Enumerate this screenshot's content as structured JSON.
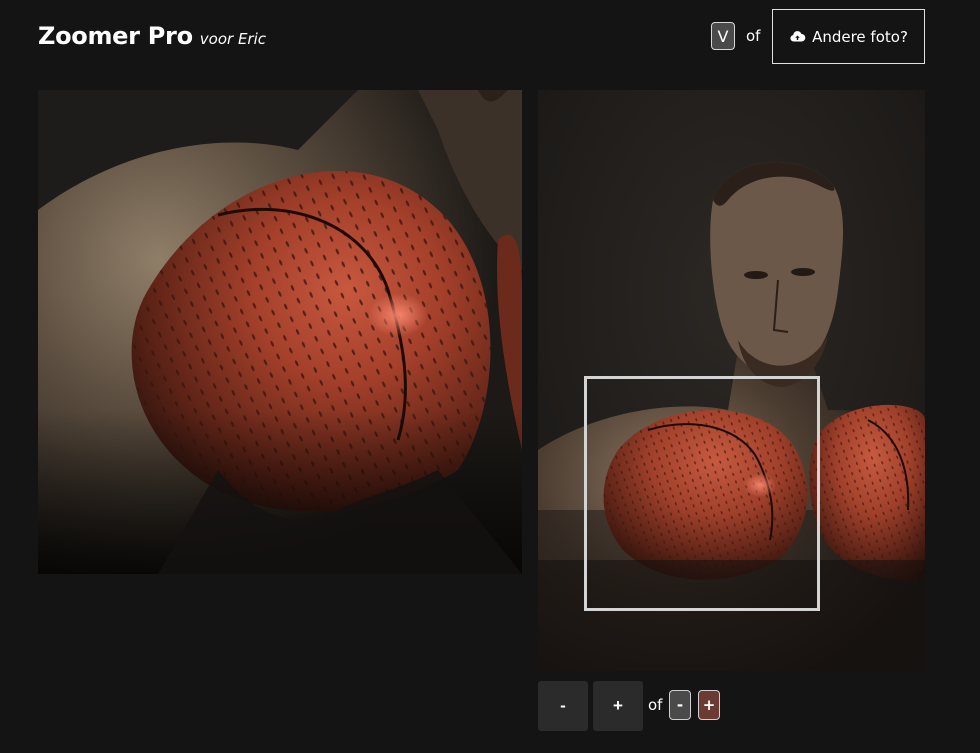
{
  "header": {
    "title": "Zoomer Pro",
    "subtitle": "voor Eric"
  },
  "toolbar": {
    "key_hint": "V",
    "or_text": "of",
    "upload_label": "Andere foto?",
    "upload_icon": "cloud-upload-icon"
  },
  "zoom_controls": {
    "minus_label": "-",
    "plus_label": "+",
    "or_text": "of",
    "key_minus": "-",
    "key_plus": "+"
  },
  "colors": {
    "background": "#141414",
    "glove_red": "#a8442c",
    "zoom_box_border": "#d4d4d4",
    "button_bg": "#2b2b2b"
  }
}
